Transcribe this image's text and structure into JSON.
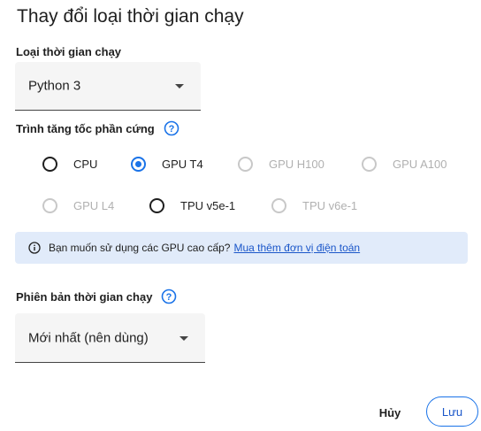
{
  "dialog": {
    "title": "Thay đổi loại thời gian chạy"
  },
  "runtime_type": {
    "label": "Loại thời gian chạy",
    "selected": "Python 3"
  },
  "hardware": {
    "label": "Trình tăng tốc phần cứng",
    "options": [
      {
        "label": "CPU",
        "checked": false,
        "disabled": false
      },
      {
        "label": "GPU T4",
        "checked": true,
        "disabled": false
      },
      {
        "label": "GPU H100",
        "checked": false,
        "disabled": true
      },
      {
        "label": "GPU A100",
        "checked": false,
        "disabled": true
      },
      {
        "label": "GPU L4",
        "checked": false,
        "disabled": true
      },
      {
        "label": "TPU v5e-1",
        "checked": false,
        "disabled": false
      },
      {
        "label": "TPU v6e-1",
        "checked": false,
        "disabled": true
      }
    ]
  },
  "banner": {
    "text": "Bạn muốn sử dụng các GPU cao cấp?",
    "link": "Mua thêm đơn vị điện toán"
  },
  "runtime_version": {
    "label": "Phiên bản thời gian chạy",
    "selected": "Mới nhất (nên dùng)"
  },
  "actions": {
    "cancel": "Hủy",
    "save": "Lưu"
  },
  "colors": {
    "accent": "#1a73e8",
    "banner_bg": "#e1ebfa",
    "disabled": "#b0b0b0"
  }
}
